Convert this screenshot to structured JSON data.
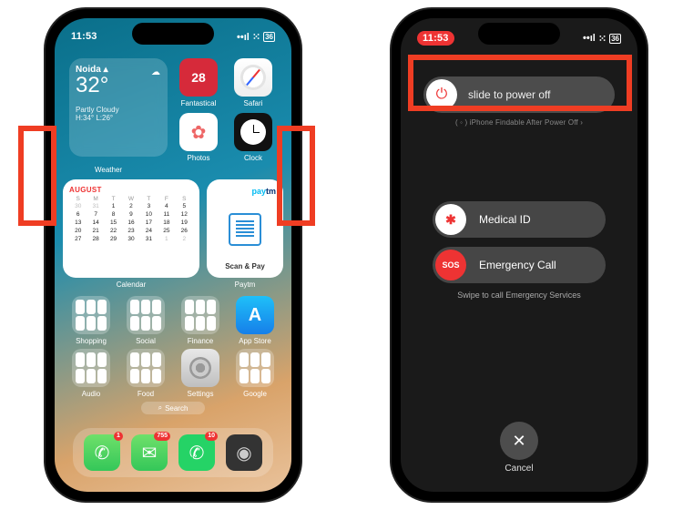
{
  "status": {
    "time": "11:53",
    "battery": "36",
    "signal": "•••",
    "cell": "⁙"
  },
  "left": {
    "weather": {
      "location": "Noida",
      "arrow": "▴",
      "temp": "32°",
      "cloud_icon": "☁︎",
      "condition": "Partly Cloudy",
      "hilo": "H:34° L:26°",
      "label": "Weather"
    },
    "apps_row1": [
      {
        "name": "fantastical",
        "label": "Fantastical",
        "glyph": "28",
        "cls": "ic-fantastical",
        "glyph_color": "#fff"
      },
      {
        "name": "safari",
        "label": "Safari",
        "glyph": "",
        "cls": "ic-safari"
      }
    ],
    "apps_row2": [
      {
        "name": "photos",
        "label": "Photos",
        "glyph": "✿",
        "cls": "ic-photos",
        "glyph_color": "#e66"
      },
      {
        "name": "clock",
        "label": "Clock",
        "glyph": "",
        "cls": "ic-clock"
      }
    ],
    "calendar": {
      "month": "AUGUST",
      "dow": [
        "S",
        "M",
        "T",
        "W",
        "T",
        "F",
        "S"
      ],
      "weeks": [
        [
          "30",
          "31",
          "1",
          "2",
          "3",
          "4",
          "5"
        ],
        [
          "6",
          "7",
          "8",
          "9",
          "10",
          "11",
          "12"
        ],
        [
          "13",
          "14",
          "15",
          "16",
          "17",
          "18",
          "19"
        ],
        [
          "20",
          "21",
          "22",
          "23",
          "24",
          "25",
          "26"
        ],
        [
          "27",
          "28",
          "29",
          "30",
          "31",
          "1",
          "2"
        ]
      ],
      "label": "Calendar"
    },
    "paytm": {
      "brand_pay": "pay",
      "brand_tm": "tm",
      "scan": "Scan & Pay",
      "label": "Paytm"
    },
    "folders_row1": [
      {
        "label": "Shopping"
      },
      {
        "label": "Social"
      },
      {
        "label": "Finance"
      }
    ],
    "appstore": {
      "label": "App Store",
      "glyph": "A",
      "cls": "ic-appstore"
    },
    "folders_row2": [
      {
        "label": "Audio"
      },
      {
        "label": "Food"
      }
    ],
    "settings": {
      "label": "Settings",
      "cls": "ic-settings"
    },
    "google": {
      "label": "Google"
    },
    "search": "Search",
    "search_icon": "⌕",
    "dock": [
      {
        "name": "phone",
        "cls": "ic-phone",
        "glyph": "✆",
        "badge": "1"
      },
      {
        "name": "messages",
        "cls": "ic-msg",
        "glyph": "✉︎",
        "badge": "755"
      },
      {
        "name": "whatsapp",
        "cls": "ic-wa",
        "glyph": "✆",
        "badge": "10"
      },
      {
        "name": "camera",
        "cls": "ic-cam",
        "glyph": "◉",
        "badge": ""
      }
    ]
  },
  "right": {
    "power_icon": "⏻",
    "slide_text": "slide to power off",
    "findable": "( ◦ ) iPhone Findable After Power Off ›",
    "medical_glyph": "✱",
    "medical": "Medical ID",
    "sos_glyph": "SOS",
    "sos": "Emergency Call",
    "swipe": "Swipe to call Emergency Services",
    "cancel_glyph": "✕",
    "cancel": "Cancel"
  }
}
